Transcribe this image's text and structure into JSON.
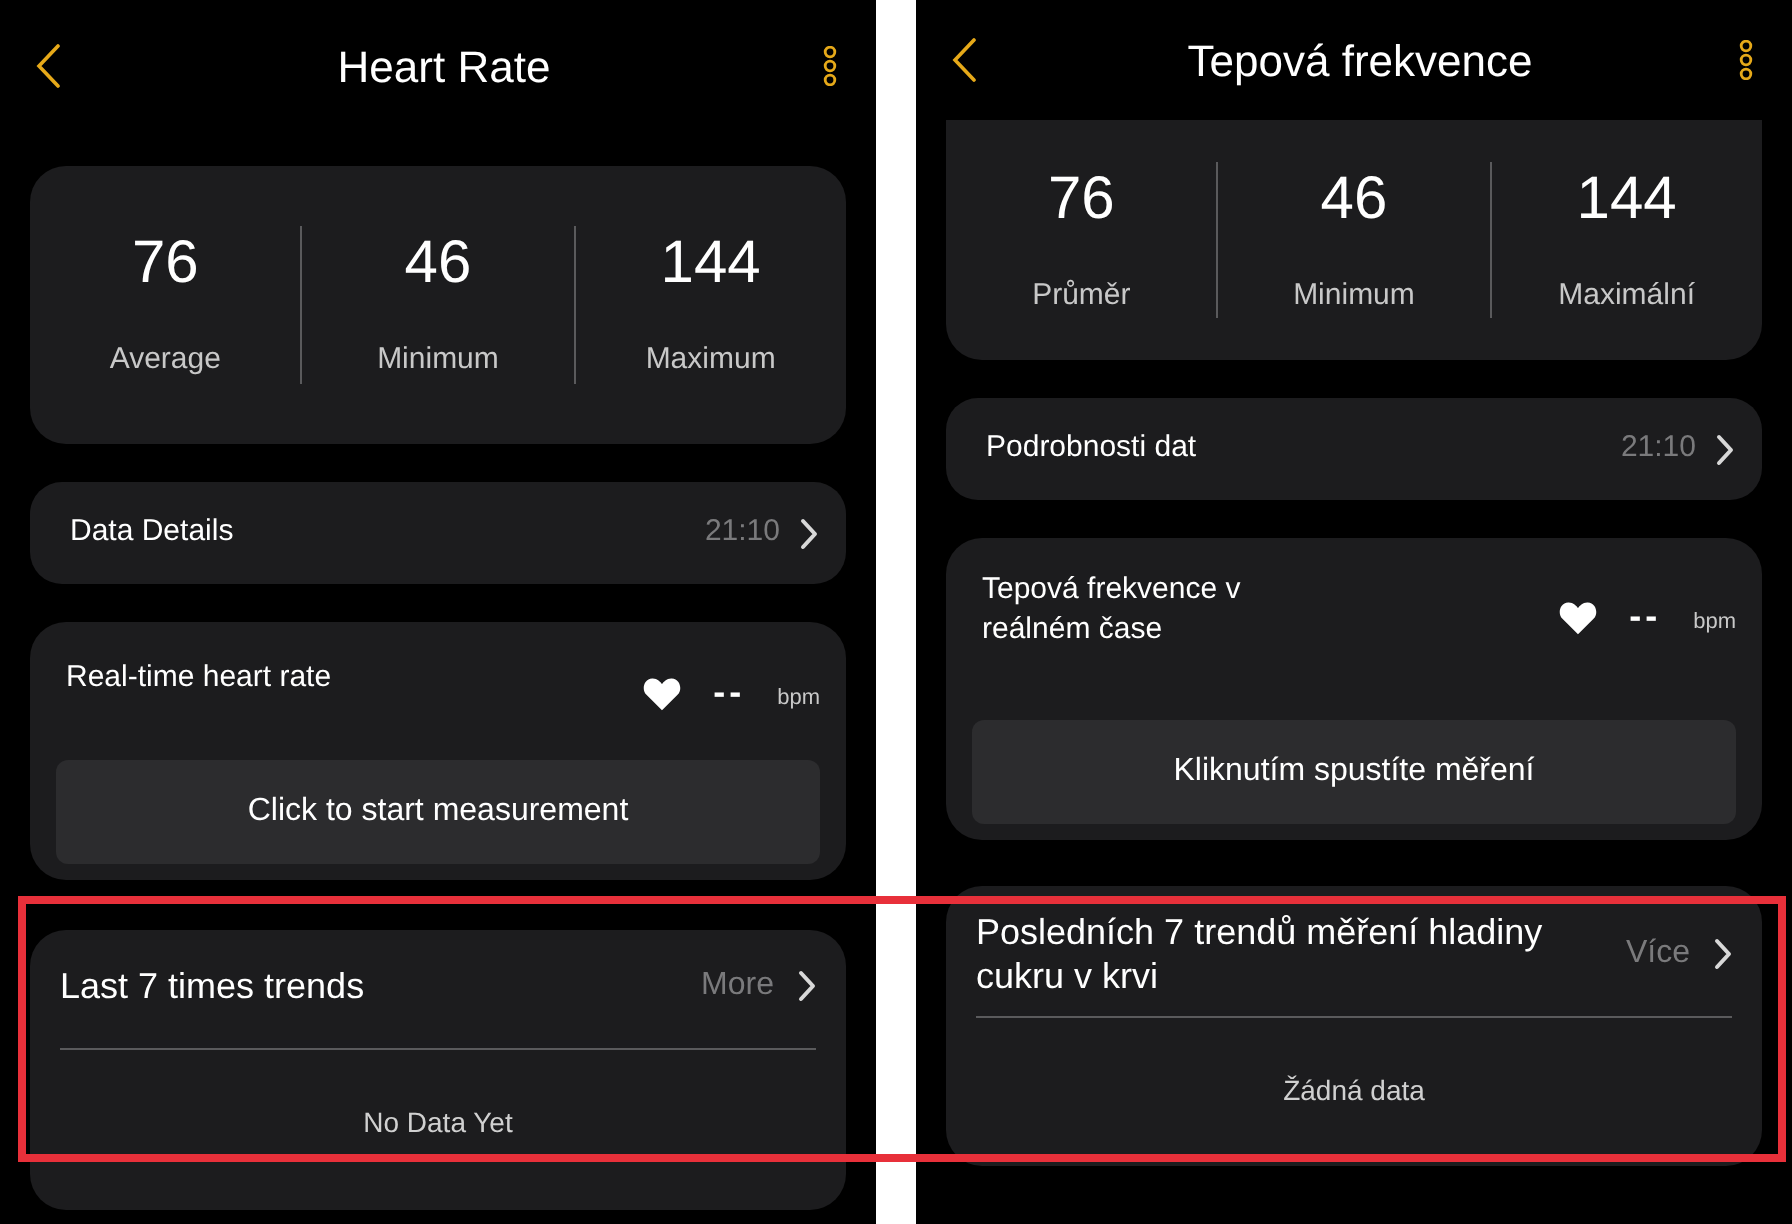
{
  "phones": [
    {
      "title": "Heart Rate",
      "scrolled": false,
      "stats": [
        {
          "value": "76",
          "label": "Average"
        },
        {
          "value": "46",
          "label": "Minimum"
        },
        {
          "value": "144",
          "label": "Maximum"
        }
      ],
      "details": {
        "label": "Data Details",
        "time": "21:10"
      },
      "realtime": {
        "label": "Real-time heart rate",
        "value": "--",
        "unit": "bpm",
        "button": "Click to start measurement"
      },
      "trends": {
        "title": "Last 7 times trends",
        "more": "More",
        "empty": "No Data Yet"
      }
    },
    {
      "title": "Tepová frekvence",
      "scrolled": true,
      "stats": [
        {
          "value": "76",
          "label": "Průměr"
        },
        {
          "value": "46",
          "label": "Minimum"
        },
        {
          "value": "144",
          "label": "Maximální"
        }
      ],
      "details": {
        "label": "Podrobnosti dat",
        "time": "21:10"
      },
      "realtime": {
        "label": "Tepová frekvence v reálném čase",
        "value": "--",
        "unit": "bpm",
        "button": "Kliknutím spustíte měření"
      },
      "trends": {
        "title": "Posledních 7 trendů měření hladiny cukru v krvi",
        "more": "Více",
        "empty": "Žádná data"
      }
    }
  ],
  "highlight_box": true
}
